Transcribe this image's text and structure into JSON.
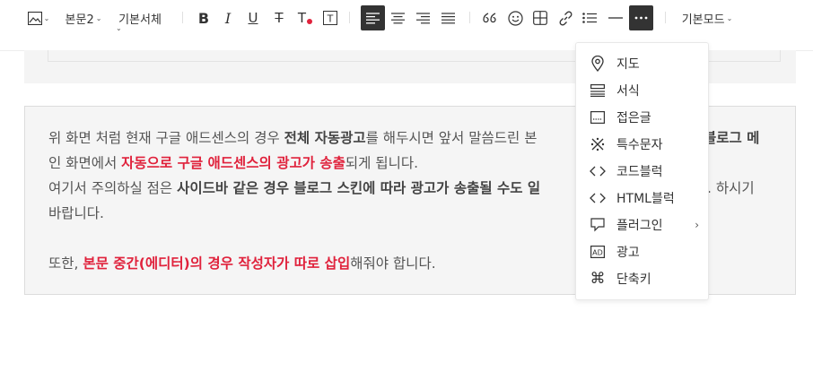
{
  "toolbar": {
    "paragraph_style": "본문2",
    "font": "기본서체",
    "mode": "기본모드"
  },
  "content": {
    "line1_a": "위 화면 처럼 현재 구글 애드센스의 경우 ",
    "line1_b": "전체 자동광고",
    "line1_c": "를 해두시면 앞서 말씀드린 본",
    "line1_d": "블로그 메",
    "line2_a": "인 화면에서 ",
    "line2_b": "자동으로 구글 애드센스의 광고가 송출",
    "line2_c": "되게 됩니다.",
    "line3_a": "여기서 주의하실 점은 ",
    "line3_b": "사이드바 같은 경우 블로그 스킨에 따라 광고가 송출될 수도 일",
    "line3_c": ". 하시기",
    "line4": "바랍니다.",
    "line5_a": "또한, ",
    "line5_b": "본문 중간(에디터)의 경우 작성자가 따로 삽입",
    "line5_c": "해줘야 합니다."
  },
  "menu": {
    "items": [
      {
        "label": "지도",
        "icon": "map-pin-icon"
      },
      {
        "label": "서식",
        "icon": "template-icon"
      },
      {
        "label": "접은글",
        "icon": "fold-icon"
      },
      {
        "label": "특수문자",
        "icon": "special-char-icon"
      },
      {
        "label": "코드블럭",
        "icon": "code-icon"
      },
      {
        "label": "HTML블럭",
        "icon": "html-icon"
      },
      {
        "label": "플러그인",
        "icon": "plugin-icon"
      },
      {
        "label": "광고",
        "icon": "ad-icon"
      },
      {
        "label": "단축키",
        "icon": "command-icon"
      }
    ]
  }
}
